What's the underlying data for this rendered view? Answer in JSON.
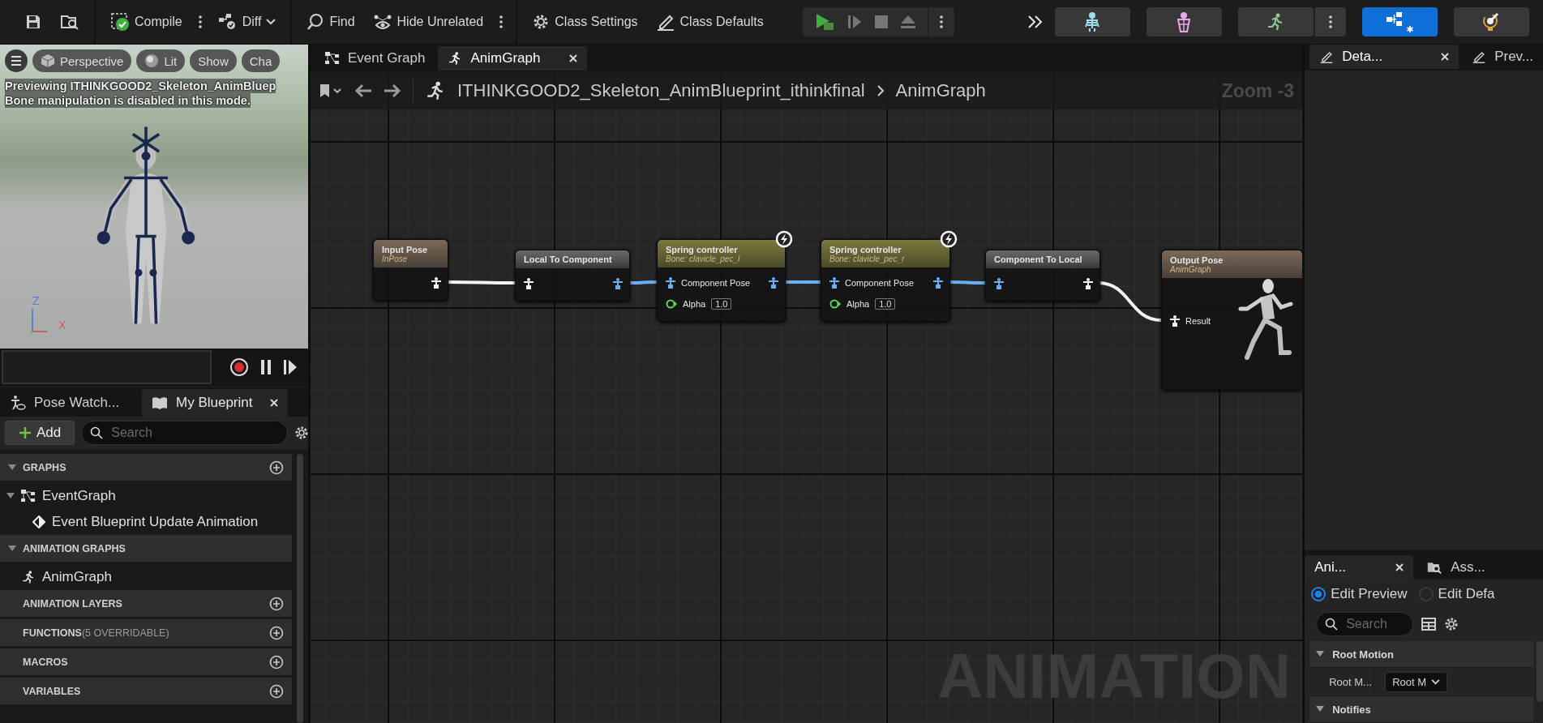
{
  "toolbar": {
    "groups": [
      [
        {
          "kind": "save"
        },
        {
          "kind": "browse"
        }
      ],
      [
        {
          "kind": "compile",
          "label": "Compile",
          "menu": true
        },
        {
          "kind": "diff",
          "label": "Diff",
          "dropdown": true
        }
      ],
      [
        {
          "kind": "find",
          "label": "Find"
        },
        {
          "kind": "hide",
          "label": "Hide Unrelated",
          "menu": true
        }
      ],
      [
        {
          "kind": "settings",
          "label": "Class Settings"
        },
        {
          "kind": "defaults",
          "label": "Class Defaults"
        }
      ]
    ],
    "modes": [
      {
        "kind": "skeleton",
        "selected": false
      },
      {
        "kind": "mesh",
        "selected": false
      },
      {
        "kind": "animation",
        "selected": false,
        "menu": true
      },
      {
        "kind": "blueprint",
        "selected": true
      },
      {
        "kind": "physics",
        "selected": false
      }
    ]
  },
  "viewport": {
    "buttons": [
      {
        "kind": "menu"
      },
      {
        "kind": "perspective",
        "label": "Perspective"
      },
      {
        "kind": "lit",
        "label": "Lit"
      },
      {
        "kind": "plain",
        "label": "Show"
      },
      {
        "kind": "plain",
        "label": "Cha"
      }
    ],
    "messages": [
      "Previewing ITHINKGOOD2_Skeleton_AnimBluep",
      "Bone manipulation is disabled in this mode."
    ],
    "axes": [
      "Z",
      "X"
    ]
  },
  "left_panel": {
    "tabs": [
      {
        "kind": "pose",
        "label": "Pose Watch...",
        "selected": false
      },
      {
        "kind": "book",
        "label": "My Blueprint",
        "selected": true
      }
    ],
    "add_button": "Add",
    "search": {
      "placeholder": "Search"
    },
    "sections": [
      {
        "label": "GRAPHS",
        "expanded": true,
        "addable": true,
        "items": [
          {
            "kind": "graph",
            "label": "EventGraph",
            "expanded": true,
            "children": [
              {
                "kind": "event",
                "label": "Event Blueprint Update Animation"
              }
            ]
          }
        ]
      },
      {
        "label": "ANIMATION GRAPHS",
        "expanded": true,
        "addable": false,
        "items": [
          {
            "kind": "anim",
            "label": "AnimGraph"
          }
        ]
      },
      {
        "label": "ANIMATION LAYERS",
        "expanded": false,
        "addable": true
      },
      {
        "label": "FUNCTIONS",
        "note": "(5 OVERRIDABLE)",
        "expanded": false,
        "addable": true
      },
      {
        "label": "MACROS",
        "expanded": false,
        "addable": true
      },
      {
        "label": "VARIABLES",
        "expanded": false,
        "addable": true
      }
    ]
  },
  "graph": {
    "tabs": [
      {
        "kind": "event",
        "label": "Event Graph",
        "selected": false
      },
      {
        "kind": "anim",
        "label": "AnimGraph",
        "selected": true
      }
    ],
    "breadcrumb": [
      "ITHINKGOOD2_Skeleton_AnimBlueprint_ithinkfinal",
      "AnimGraph"
    ],
    "zoom": "Zoom -3",
    "watermark": "ANIMATION",
    "nodes": [
      {
        "kind": "input",
        "title": "Input Pose",
        "subtitle": "InPose",
        "fast_path": false,
        "outputs": [
          {
            "kind": "pose",
            "color": "#f2f2f2"
          }
        ]
      },
      {
        "kind": "convert",
        "title": "Local To Component",
        "fast_path": false,
        "inputs": [
          {
            "kind": "pose",
            "color": "#f2f2f2"
          }
        ],
        "outputs": [
          {
            "kind": "pose",
            "color": "#6ab0f0"
          }
        ]
      },
      {
        "kind": "controller",
        "title": "Spring controller",
        "subtitle": "Bone: clavicle_pec_l",
        "fast_path": true,
        "inputs": [
          {
            "kind": "pose",
            "color": "#6ab0f0",
            "label": "Component Pose"
          },
          {
            "kind": "float",
            "label": "Alpha",
            "value": "1.0"
          }
        ],
        "outputs": [
          {
            "kind": "pose",
            "color": "#6ab0f0"
          }
        ]
      },
      {
        "kind": "controller",
        "title": "Spring controller",
        "subtitle": "Bone: clavicle_pec_r",
        "fast_path": true,
        "inputs": [
          {
            "kind": "pose",
            "color": "#6ab0f0",
            "label": "Component Pose"
          },
          {
            "kind": "float",
            "label": "Alpha",
            "value": "1.0"
          }
        ],
        "outputs": [
          {
            "kind": "pose",
            "color": "#6ab0f0"
          }
        ]
      },
      {
        "kind": "convert",
        "title": "Component To Local",
        "fast_path": false,
        "inputs": [
          {
            "kind": "pose",
            "color": "#6ab0f0"
          }
        ],
        "outputs": [
          {
            "kind": "pose",
            "color": "#f2f2f2"
          }
        ]
      },
      {
        "kind": "output",
        "title": "Output Pose",
        "subtitle": "AnimGraph",
        "fast_path": false,
        "inputs": [
          {
            "kind": "pose",
            "color": "#f2f2f2",
            "label": "Result"
          }
        ]
      }
    ]
  },
  "right_panel": {
    "tabs": [
      {
        "label": "Deta...",
        "selected": true
      },
      {
        "label": "Prev...",
        "selected": false
      }
    ],
    "lower": {
      "tabs": [
        {
          "kind": "anim",
          "label": "Ani...",
          "selected": true
        },
        {
          "kind": "asset",
          "label": "Ass...",
          "selected": false
        }
      ],
      "options": [
        {
          "label": "Edit Preview",
          "selected": true
        },
        {
          "label": "Edit Defa",
          "selected": false
        }
      ],
      "search": {
        "placeholder": "Search"
      },
      "sections": [
        {
          "label": "Root Motion",
          "expanded": true,
          "rows": [
            {
              "label": "Root M...",
              "value": "Root M"
            }
          ]
        },
        {
          "label": "Notifies",
          "expanded": true
        }
      ]
    }
  }
}
